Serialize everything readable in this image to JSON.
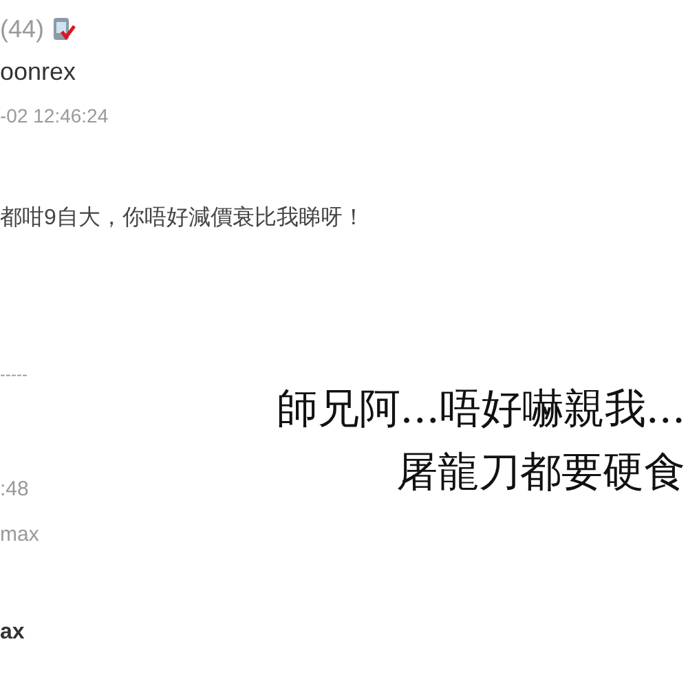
{
  "post_1": {
    "rank": "(44)",
    "username": "oonrex",
    "timestamp": "-02 12:46:24",
    "body": "都咁9自大，你唔好減價衰比我睇呀！"
  },
  "quote": {
    "separator": "-----",
    "time": ":48",
    "author": "max"
  },
  "image_caption": [
    "師兄阿...唔好嚇親我...",
    "屠龍刀都要硬食"
  ],
  "post_2": {
    "username": "ax"
  }
}
